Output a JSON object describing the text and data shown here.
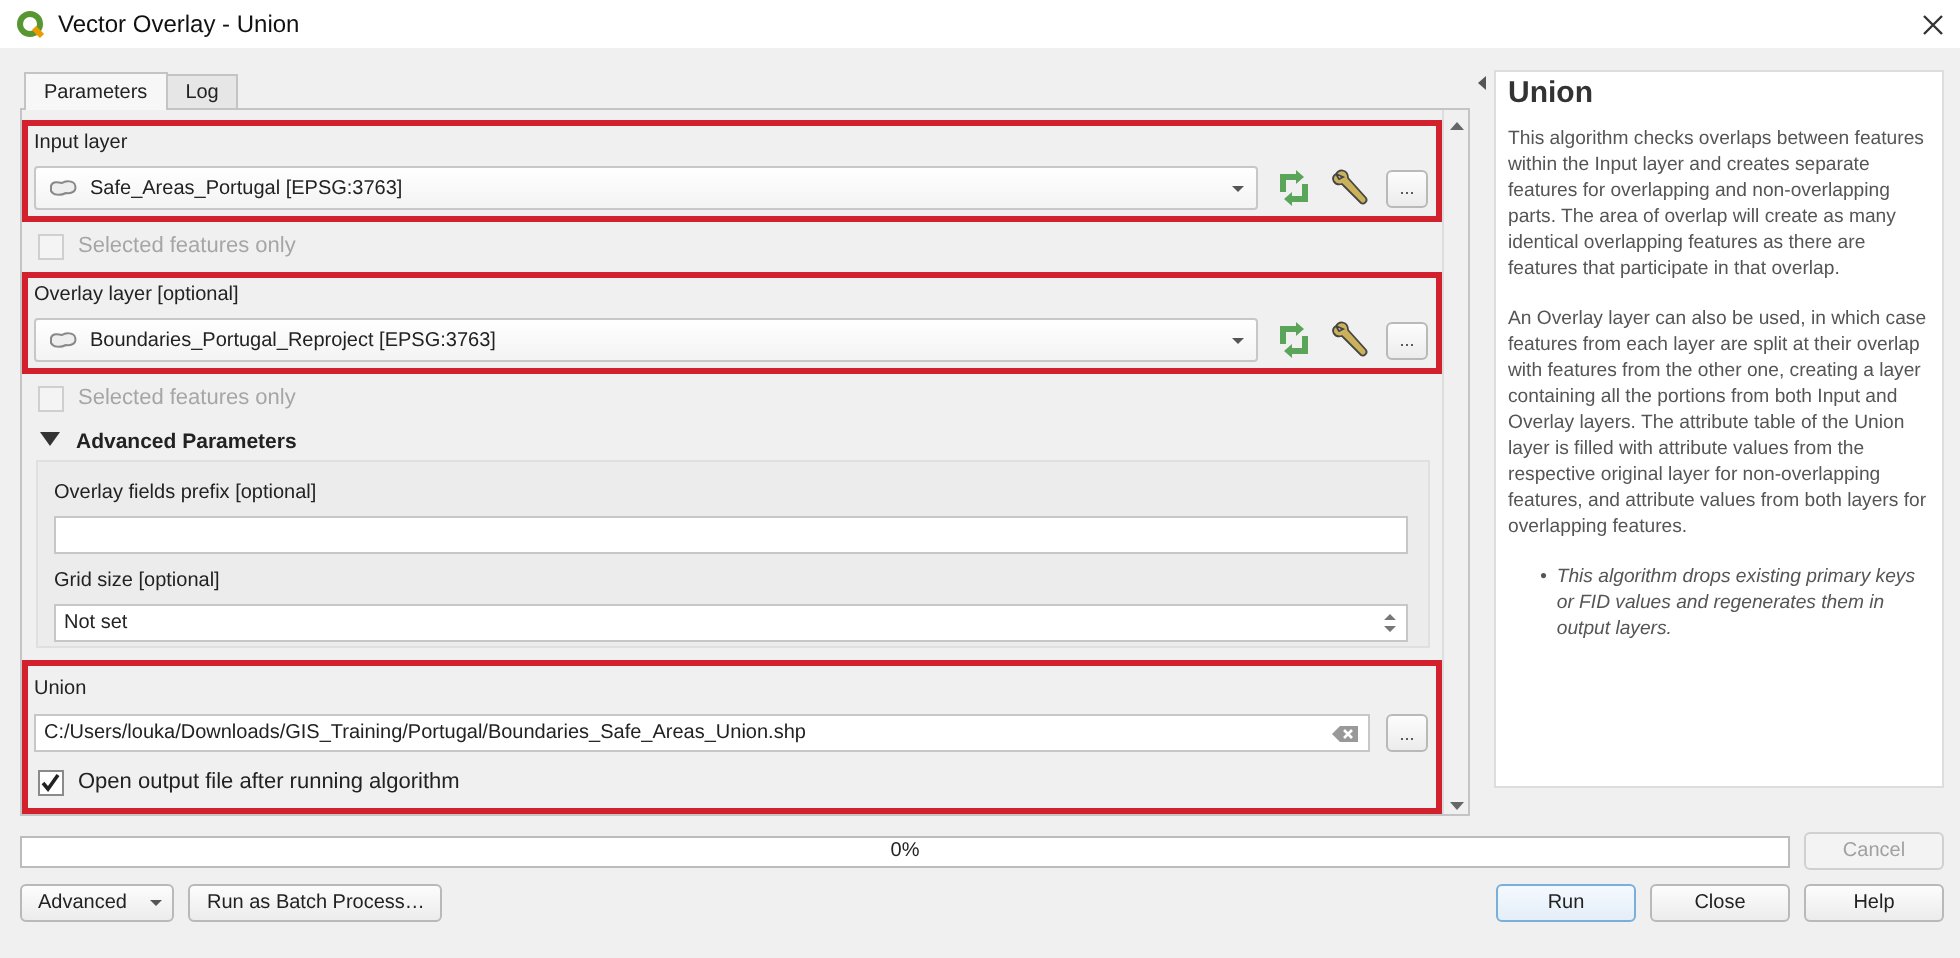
{
  "window": {
    "title": "Vector Overlay - Union"
  },
  "tabs": [
    {
      "label": "Parameters",
      "selected": true
    },
    {
      "label": "Log",
      "selected": false
    }
  ],
  "parameters": {
    "input_layer": {
      "label": "Input layer",
      "value": "Safe_Areas_Portugal [EPSG:3763]",
      "highlighted": true,
      "button": "..."
    },
    "input_selected_only": {
      "label": "Selected features only",
      "checked": false,
      "disabled": true
    },
    "overlay_layer": {
      "label": "Overlay layer [optional]",
      "value": "Boundaries_Portugal_Reproject [EPSG:3763]",
      "highlighted": true,
      "button": "..."
    },
    "overlay_selected_only": {
      "label": "Selected features only",
      "checked": false,
      "disabled": true
    },
    "advanced": {
      "label": "Advanced Parameters",
      "expanded": true,
      "prefix": {
        "label": "Overlay fields prefix [optional]"
      },
      "grid_size": {
        "label": "Grid size [optional]",
        "value": "Not set"
      }
    },
    "output": {
      "label": "Union",
      "value": "C:/Users/louka/Downloads/GIS_Training/Portugal/Boundaries_Safe_Areas_Union.shp",
      "highlighted": true,
      "button": "..."
    },
    "open_output": {
      "label": "Open output file after running algorithm",
      "checked": true,
      "disabled": false
    }
  },
  "help": {
    "title": "Union",
    "paragraphs": [
      "This algorithm checks overlaps between features within the Input layer and creates separate features for overlapping and non-overlapping parts. The area of overlap will create as many identical overlapping features as there are features that participate in that overlap.",
      "An Overlay layer can also be used, in which case features from each layer are split at their overlap with features from the other one, creating a layer containing all the portions from both Input and Overlay layers. The attribute table of the Union layer is filled with attribute values from the respective original layer for non-overlapping features, and attribute values from both layers for overlapping features."
    ],
    "notes": [
      {
        "bullet": "•",
        "text": "This algorithm drops existing primary keys or FID values and regenerates them in output layers."
      }
    ]
  },
  "progress": {
    "level": 0,
    "reading": "0%"
  },
  "cancel": {
    "label": "Cancel",
    "disabled": true
  },
  "buttons_left": [
    {
      "label": "Advanced",
      "kind": "menu"
    },
    {
      "label": "Run as Batch Process…",
      "kind": "plain"
    }
  ],
  "buttons_right": [
    {
      "label": "Run",
      "kind": "default"
    },
    {
      "label": "Close",
      "kind": "plain"
    },
    {
      "label": "Help",
      "kind": "plain"
    }
  ]
}
